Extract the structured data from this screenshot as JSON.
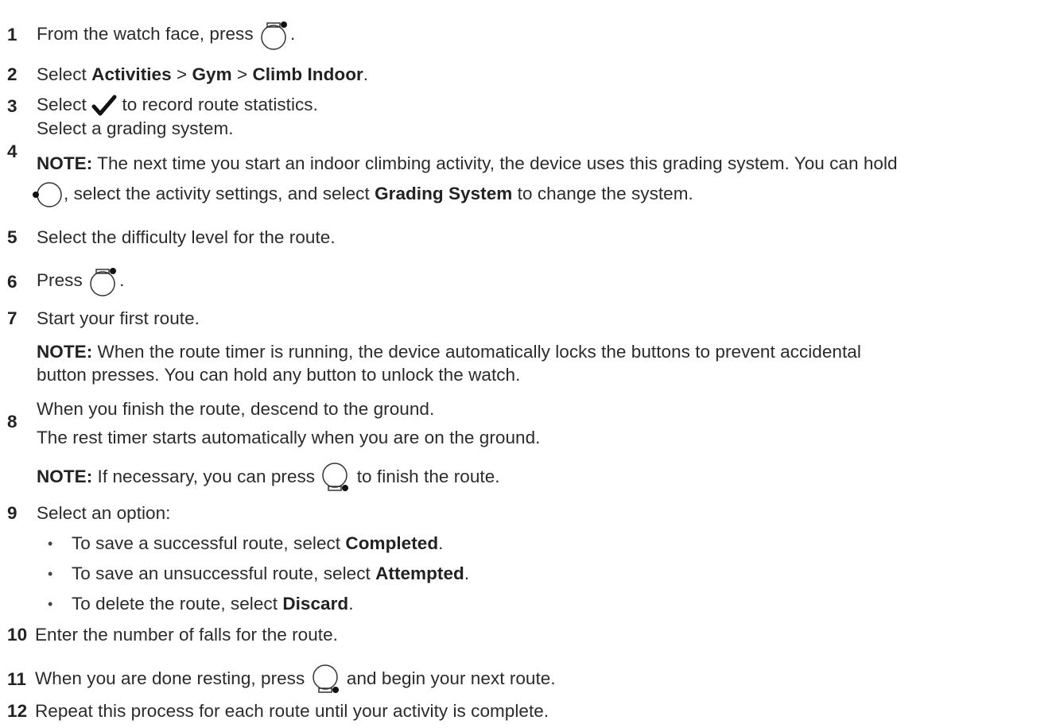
{
  "steps": [
    {
      "num": "1",
      "before": "From the watch face, press",
      "after": "."
    },
    {
      "num": "2",
      "text": "Select ",
      "b1": "Activities",
      "s1": " > ",
      "b2": "Gym",
      "s2": " > ",
      "b3": "Climb Indoor",
      "end": "."
    },
    {
      "num": "3",
      "before": "Select",
      "after": "to record route statistics."
    },
    {
      "num": "4",
      "line1": "Select a grading system.",
      "note_label": "NOTE:",
      "note_text": " The next time you start an indoor climbing activity, the device uses this grading system. You can hold",
      "cont_a": ", select the activity settings, and select ",
      "cont_b": "Grading System",
      "cont_c": " to change the system."
    },
    {
      "num": "5",
      "text": "Select the difficulty level for the route."
    },
    {
      "num": "6",
      "before": "Press",
      "after": "."
    },
    {
      "num": "7",
      "line1": "Start your first route.",
      "note_label": "NOTE:",
      "note_text": " When the route timer is running, the device automatically locks the buttons to prevent accidental",
      "note_line2": "button presses. You can hold any button to unlock the watch."
    },
    {
      "num": "8",
      "line1": "When you finish the route, descend to the ground.",
      "line2": "The rest timer starts automatically when you are on the ground.",
      "note_label": "NOTE:",
      "note_before": " If necessary, you can press",
      "note_after": "to finish the route."
    },
    {
      "num": "9",
      "text": "Select an option:"
    },
    {
      "num": "10",
      "text": "Enter the number of falls for the route."
    },
    {
      "num": "11",
      "before": "When you are done resting, press",
      "after": "and begin your next route."
    },
    {
      "num": "12",
      "text": "Repeat this process for each route until your activity is complete."
    }
  ],
  "options": [
    {
      "bullet": "•",
      "before": "To save a successful route, select ",
      "bold": "Completed",
      "after": "."
    },
    {
      "bullet": "•",
      "before": "To save an unsuccessful route, select ",
      "bold": "Attempted",
      "after": "."
    },
    {
      "bullet": "•",
      "before": "To delete the route, select ",
      "bold": "Discard",
      "after": "."
    }
  ],
  "icons": {
    "start_stop_button": "watch-top-right-button-icon",
    "light_button": "watch-left-button-icon",
    "back_lap_button": "watch-bottom-right-button-icon",
    "check": "checkmark-icon"
  }
}
